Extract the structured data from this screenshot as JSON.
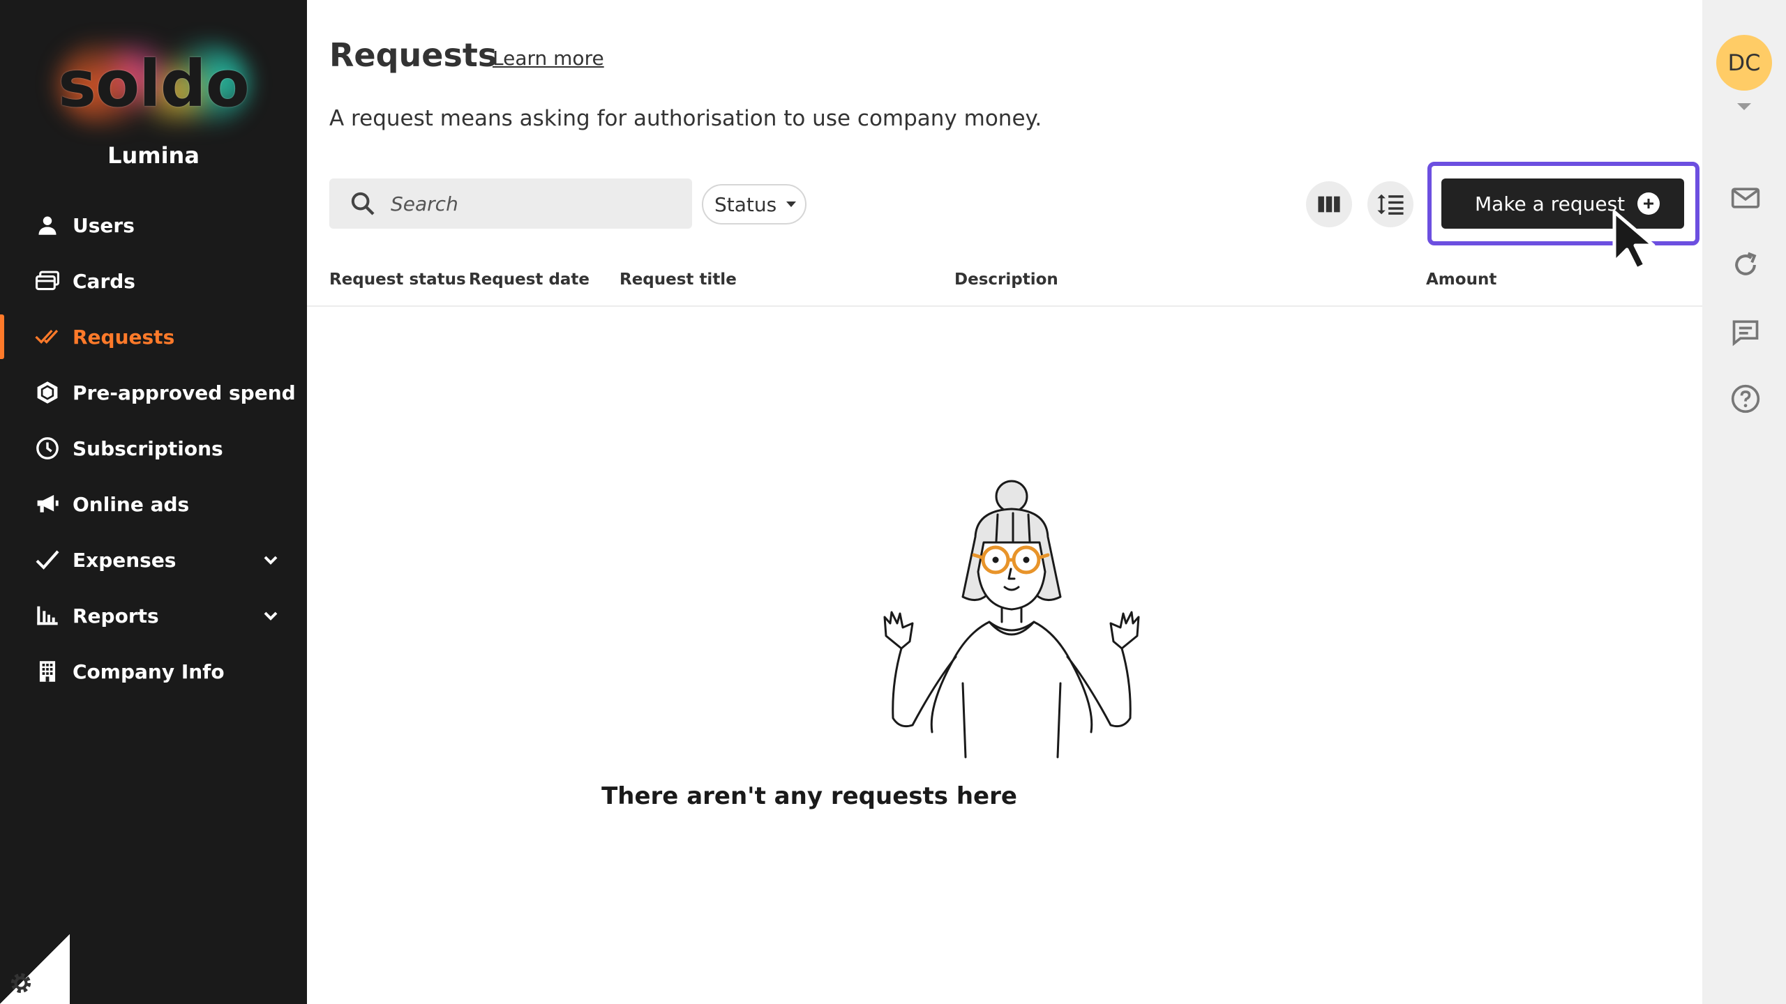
{
  "sidebar": {
    "logo_text": "soldo",
    "org_name": "Lumina",
    "items": [
      {
        "label": "Users",
        "icon": "user-icon"
      },
      {
        "label": "Cards",
        "icon": "cards-icon"
      },
      {
        "label": "Requests",
        "icon": "double-check-icon",
        "active": true
      },
      {
        "label": "Pre-approved spend",
        "icon": "hexagon-icon"
      },
      {
        "label": "Subscriptions",
        "icon": "clock-icon"
      },
      {
        "label": "Online ads",
        "icon": "megaphone-icon"
      },
      {
        "label": "Expenses",
        "icon": "check-icon",
        "expandable": true
      },
      {
        "label": "Reports",
        "icon": "bar-chart-icon",
        "expandable": true
      },
      {
        "label": "Company Info",
        "icon": "building-icon"
      }
    ]
  },
  "header": {
    "title": "Requests",
    "learn_more": "Learn more",
    "subtitle": "A request means asking for authorisation to use company money."
  },
  "toolbar": {
    "search_placeholder": "Search",
    "search_value": "",
    "status_label": "Status",
    "make_request_label": "Make a request"
  },
  "table": {
    "columns": [
      "Request status",
      "Request date",
      "Request title",
      "Description",
      "Amount"
    ]
  },
  "empty_state": {
    "message": "There aren't any requests here"
  },
  "right_rail": {
    "avatar_initials": "DC",
    "icons": [
      "mail-icon",
      "refresh-icon",
      "chat-icon",
      "help-icon"
    ]
  },
  "colors": {
    "sidebar_bg": "#1a1a1a",
    "accent": "#ff7a2a",
    "highlight": "#6c4fe0",
    "primary_button": "#222222",
    "avatar": "#ffcc66"
  }
}
